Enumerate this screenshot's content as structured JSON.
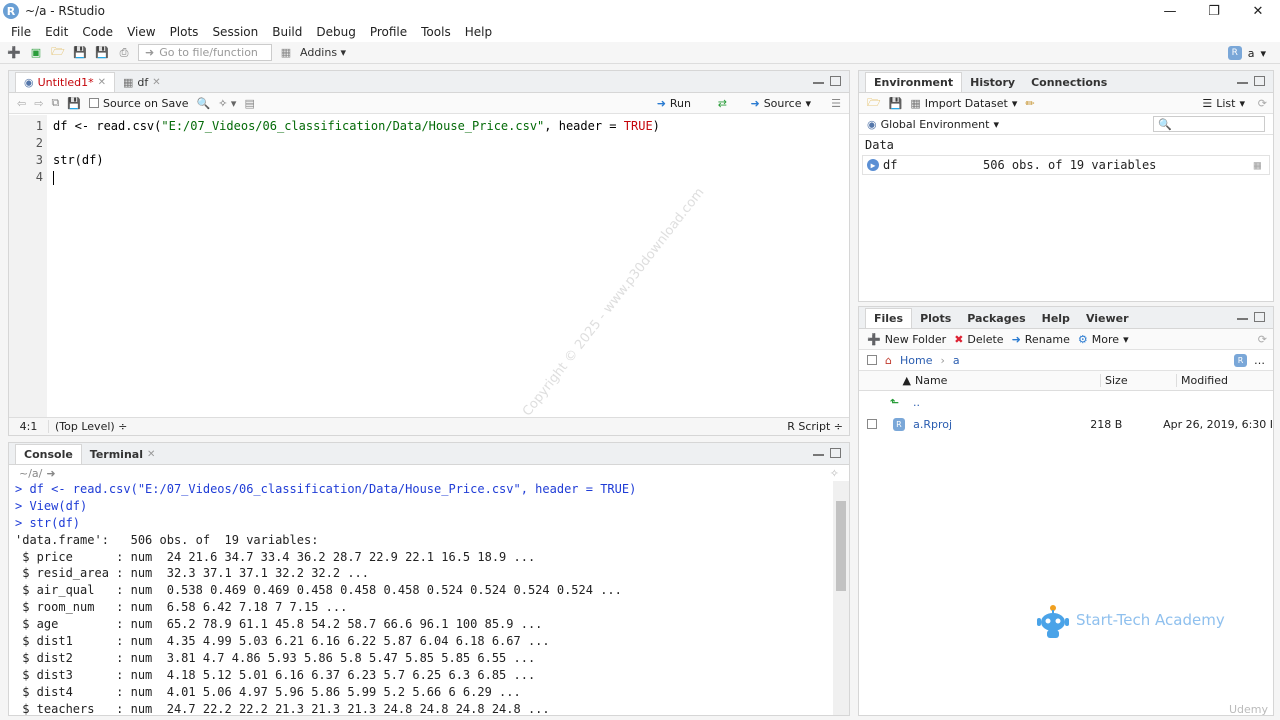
{
  "window": {
    "title": "~/a - RStudio"
  },
  "menu": [
    "File",
    "Edit",
    "Code",
    "View",
    "Plots",
    "Session",
    "Build",
    "Debug",
    "Profile",
    "Tools",
    "Help"
  ],
  "toolbar": {
    "goto_placeholder": "Go to file/function",
    "addins": "Addins",
    "user": "a"
  },
  "editor": {
    "tabs": [
      {
        "label": "Untitled1*"
      },
      {
        "label": "df"
      }
    ],
    "source_on_save": "Source on Save",
    "run": "Run",
    "source": "Source",
    "lines": [
      "1",
      "2",
      "3",
      "4"
    ],
    "code_line1_prefix": "df <- read.csv(",
    "code_line1_str": "\"E:/07_Videos/06_classification/Data/House_Price.csv\"",
    "code_line1_mid": ", header = ",
    "code_line1_kw": "TRUE",
    "code_line1_end": ")",
    "code_line3": "str(df)",
    "status_pos": "4:1",
    "status_level": "(Top Level) ÷",
    "status_type": "R Script ÷"
  },
  "console": {
    "tabs": [
      {
        "label": "Console"
      },
      {
        "label": "Terminal"
      }
    ],
    "path": "~/a/",
    "commands": [
      "df <- read.csv(\"E:/07_Videos/06_classification/Data/House_Price.csv\", header = TRUE)",
      "View(df)",
      "str(df)"
    ],
    "output": [
      "'data.frame':\t506 obs. of  19 variables:",
      " $ price      : num  24 21.6 34.7 33.4 36.2 28.7 22.9 22.1 16.5 18.9 ...",
      " $ resid_area : num  32.3 37.1 37.1 32.2 32.2 ...",
      " $ air_qual   : num  0.538 0.469 0.469 0.458 0.458 0.458 0.524 0.524 0.524 0.524 ...",
      " $ room_num   : num  6.58 6.42 7.18 7 7.15 ...",
      " $ age        : num  65.2 78.9 61.1 45.8 54.2 58.7 66.6 96.1 100 85.9 ...",
      " $ dist1      : num  4.35 4.99 5.03 6.21 6.16 6.22 5.87 6.04 6.18 6.67 ...",
      " $ dist2      : num  3.81 4.7 4.86 5.93 5.86 5.8 5.47 5.85 5.85 6.55 ...",
      " $ dist3      : num  4.18 5.12 5.01 6.16 6.37 6.23 5.7 6.25 6.3 6.85 ...",
      " $ dist4      : num  4.01 5.06 4.97 5.96 5.86 5.99 5.2 5.66 6 6.29 ...",
      " $ teachers   : num  24.7 22.2 22.2 21.3 21.3 21.3 24.8 24.8 24.8 24.8 ..."
    ]
  },
  "environment": {
    "tabs": [
      {
        "label": "Environment"
      },
      {
        "label": "History"
      },
      {
        "label": "Connections"
      }
    ],
    "import_dataset": "Import Dataset",
    "list": "List",
    "global_env": "Global Environment",
    "data_header": "Data",
    "objects": [
      {
        "name": "df",
        "value": "506 obs. of 19 variables"
      }
    ]
  },
  "files": {
    "tabs": [
      {
        "label": "Files"
      },
      {
        "label": "Plots"
      },
      {
        "label": "Packages"
      },
      {
        "label": "Help"
      },
      {
        "label": "Viewer"
      }
    ],
    "new_folder": "New Folder",
    "delete": "Delete",
    "rename": "Rename",
    "more": "More",
    "breadcrumb_home": "Home",
    "breadcrumb_dir": "a",
    "col_name": "Name",
    "col_size": "Size",
    "col_modified": "Modified",
    "parent": "..",
    "rows": [
      {
        "name": "a.Rproj",
        "size": "218 B",
        "modified": "Apr 26, 2019, 6:30 I"
      }
    ]
  },
  "overlay": {
    "watermark": "Copyright © 2025 - www.p30download.com",
    "brand": "Start-Tech Academy",
    "udemy": "Udemy"
  }
}
